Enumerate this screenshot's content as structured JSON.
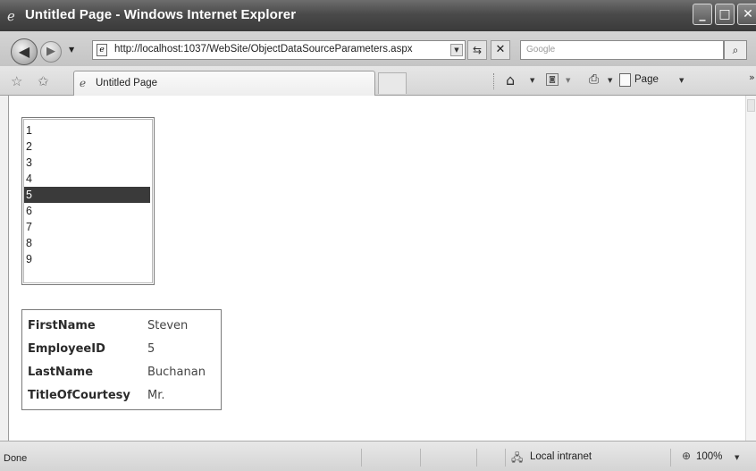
{
  "window": {
    "title": "Untitled Page - Windows Internet Explorer",
    "minimize_glyph": "_",
    "maximize_glyph": "□",
    "close_glyph": "✕"
  },
  "navigation": {
    "url": "http://localhost:1037/WebSite/ObjectDataSourceParameters.aspx",
    "search_placeholder": "Google"
  },
  "tabs": [
    {
      "label": "Untitled Page",
      "active": true
    }
  ],
  "command_bar": {
    "page_label": "Page"
  },
  "page": {
    "listbox": {
      "items": [
        "1",
        "2",
        "3",
        "4",
        "5",
        "6",
        "7",
        "8",
        "9"
      ],
      "selected": "5",
      "selected_color": "#3a3a3a"
    },
    "details": {
      "rows": [
        {
          "field": "FirstName",
          "value": "Steven"
        },
        {
          "field": "EmployeeID",
          "value": "5"
        },
        {
          "field": "LastName",
          "value": "Buchanan"
        },
        {
          "field": "TitleOfCourtesy",
          "value": "Mr."
        }
      ]
    }
  },
  "status_bar": {
    "status": "Done",
    "zone": "Local intranet",
    "zoom": "100%"
  },
  "icons": {
    "window": "ie-icon",
    "back": "back-arrow-icon",
    "forward": "forward-arrow-icon",
    "refresh": "refresh-icon",
    "stop": "stop-icon",
    "search": "search-icon",
    "favorites": "star-icon",
    "add_favorites": "add-star-icon",
    "home": "home-icon",
    "feeds": "feed-icon",
    "print": "print-icon",
    "page": "page-icon",
    "zone": "intranet-icon",
    "zoom": "zoom-icon"
  }
}
